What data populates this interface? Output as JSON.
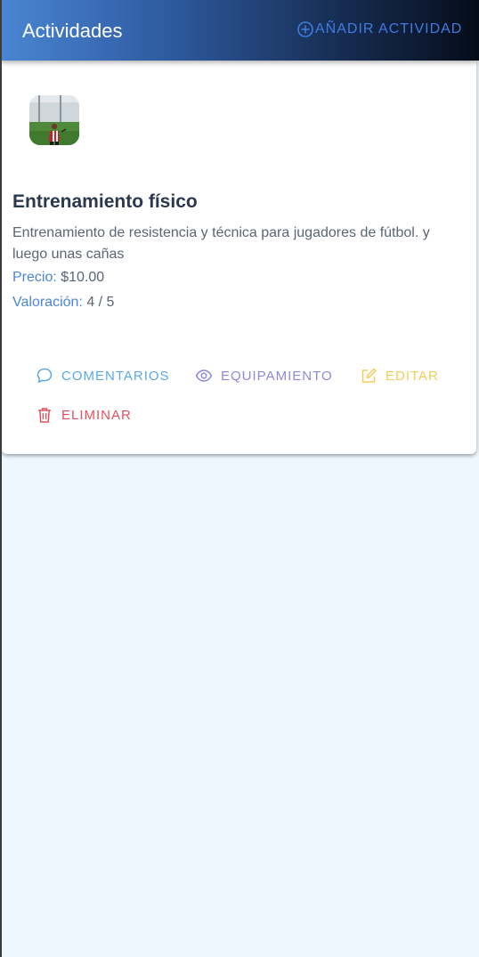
{
  "header": {
    "title": "Actividades",
    "add_label": "AÑADIR ACTIVIDAD"
  },
  "activity": {
    "image_alt": "Jugador de fútbol",
    "title": "Entrenamiento físico",
    "description": "Entrenamiento de resistencia y técnica para jugadores de fútbol. y luego unas cañas",
    "price_label": "Precio:",
    "price_value": "$10.00",
    "rating_label": "Valoración:",
    "rating_value": "4 / 5"
  },
  "actions": {
    "comments": "COMENTARIOS",
    "equipment": "EQUIPAMIENTO",
    "edit": "EDITAR",
    "delete": "ELIMINAR"
  },
  "colors": {
    "accent": "#4a86d3",
    "comments": "#5aa9e6",
    "equipment": "#8c88e2",
    "edit": "#f2ce5a",
    "delete": "#e0525f",
    "background": "#eef6fe"
  }
}
